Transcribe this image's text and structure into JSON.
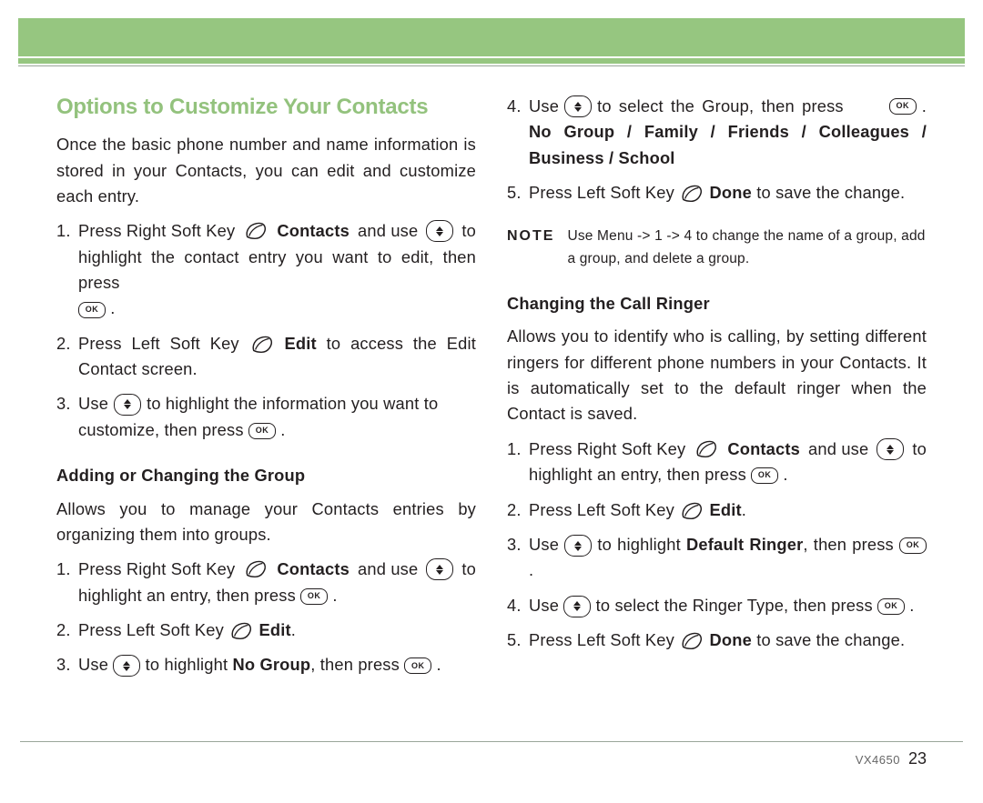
{
  "title": "Options to Customize Your Contacts",
  "intro": "Once the basic phone number and name information is stored in your Contacts, you can edit and customize each entry.",
  "mainSteps": {
    "s1_a": "Press Right Soft Key",
    "s1_b": "Contacts",
    "s1_c": "and use",
    "s1_d": "to",
    "s1_e": "highlight the contact entry you want to edit, then press",
    "s2_a": "Press Left Soft Key",
    "s2_b": "Edit",
    "s2_c": " to access the Edit Contact screen.",
    "s3_a": "Use",
    "s3_b": "to highlight the information you want to",
    "s3_c": "customize, then press"
  },
  "group": {
    "heading": "Adding or Changing the Group",
    "intro": "Allows you to manage your Contacts entries by organizing them into groups.",
    "s1_a": "Press Right Soft Key",
    "s1_b": "Contacts",
    "s1_c": "and use",
    "s1_d": "to",
    "s1_e": "highlight an entry, then press",
    "s2_a": "Press Left Soft Key",
    "s2_b": "Edit",
    "s3_a": "Use",
    "s3_b": "to highlight",
    "s3_c": "No Group",
    "s3_d": ", then press",
    "s4_a": "Use",
    "s4_b": "to select the Group, then press",
    "s4_c": "No Group / Family / Friends / Colleagues / Business / School",
    "s5_a": "Press Left Soft Key",
    "s5_b": "Done",
    "s5_c": " to save the change."
  },
  "note": {
    "label": "NOTE",
    "text": "Use Menu -> 1 -> 4 to change the name of a group, add a group, and delete a group."
  },
  "ringer": {
    "heading": "Changing the Call Ringer",
    "intro": "Allows you to identify who is calling, by setting different ringers for different phone numbers in your Contacts. It is automatically set to the default ringer when the Contact is saved.",
    "s1_a": "Press Right Soft Key",
    "s1_b": "Contacts",
    "s1_c": "and use",
    "s1_d": "to",
    "s1_e": "highlight an entry, then press",
    "s2_a": "Press Left Soft Key",
    "s2_b": "Edit",
    "s3_a": "Use",
    "s3_b": "to highlight",
    "s3_c": "Default Ringer",
    "s3_d": ", then press",
    "s4_a": "Use",
    "s4_b": "to select the Ringer Type, then press",
    "s5_a": "Press Left Soft Key",
    "s5_b": "Done",
    "s5_c": " to save the change."
  },
  "footer": {
    "model": "VX4650",
    "page": "23"
  },
  "okLabel": "OK"
}
